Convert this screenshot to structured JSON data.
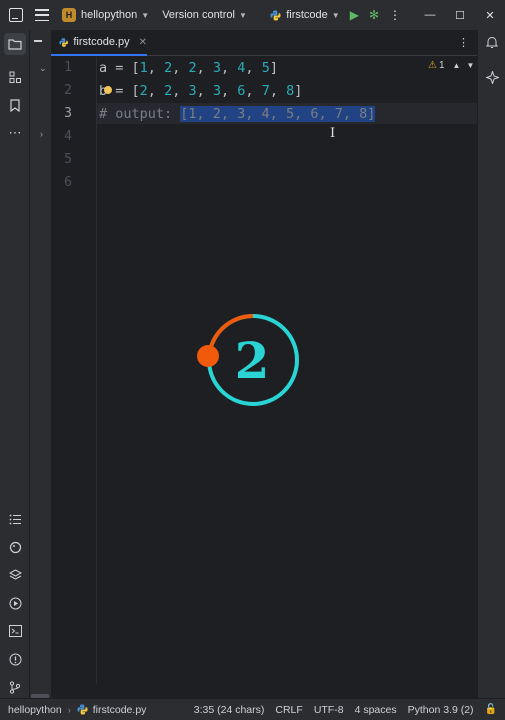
{
  "titlebar": {
    "project_badge": "H",
    "project_name": "hellopython",
    "vcs_label": "Version control",
    "run_config": "firstcode",
    "window_controls": [
      "minimize-icon",
      "maximize-icon",
      "close-icon"
    ]
  },
  "tabs": [
    {
      "label": "firstcode.py",
      "active": true
    }
  ],
  "editor": {
    "line_numbers": [
      "1",
      "2",
      "3",
      "4",
      "5",
      "6"
    ],
    "current_line": "3",
    "lines": {
      "l1": {
        "var": "a",
        "eq": " = [",
        "n": [
          "1",
          "2",
          "2",
          "3",
          "4",
          "5"
        ],
        "close": "]"
      },
      "l2": {
        "var": "b",
        "eq": " = [",
        "n": [
          "2",
          "2",
          "3",
          "3",
          "6",
          "7",
          "8"
        ],
        "close": "]"
      },
      "l3": {
        "comment_prefix": "# output: ",
        "selected": "[1, 2, 3, 4, 5, 6, 7, 8]"
      }
    },
    "inspections": {
      "warning_count": "1"
    }
  },
  "overlay": {
    "step_number": "2"
  },
  "statusbar": {
    "breadcrumb_project": "hellopython",
    "breadcrumb_file": "firstcode.py",
    "caret_position": "3:35 (24 chars)",
    "line_separator": "CRLF",
    "encoding": "UTF-8",
    "indent": "4 spaces",
    "interpreter": "Python 3.9 (2)"
  },
  "colors": {
    "accent": "#3574f0",
    "number": "#2aacb8",
    "comment": "#7a7e85",
    "selection": "#214283",
    "overlay_ring": "#2ad4d4",
    "overlay_dot": "#f05a0a"
  }
}
